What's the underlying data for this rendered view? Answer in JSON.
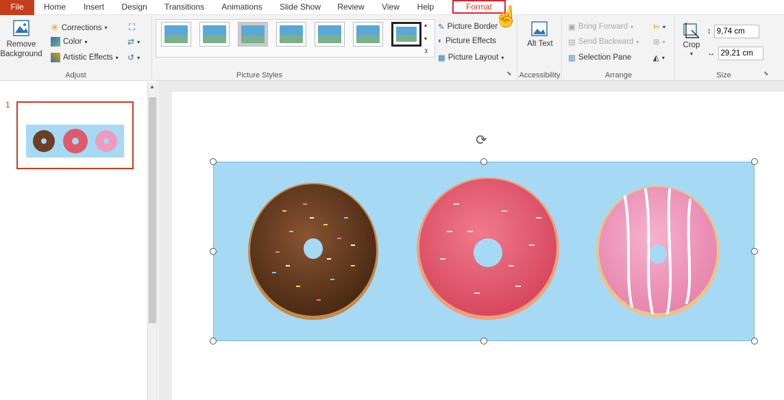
{
  "tabs": [
    "File",
    "Home",
    "Insert",
    "Design",
    "Transitions",
    "Animations",
    "Slide Show",
    "Review",
    "View",
    "Help",
    "Format"
  ],
  "ribbon": {
    "adjust": {
      "remove_bg": "Remove Background",
      "corrections": "Corrections",
      "color": "Color",
      "artistic": "Artistic Effects",
      "label": "Adjust"
    },
    "picture_styles": {
      "border": "Picture Border",
      "effects": "Picture Effects",
      "layout": "Picture Layout",
      "label": "Picture Styles"
    },
    "accessibility": {
      "alt_text": "Alt Text",
      "label": "Accessibility"
    },
    "arrange": {
      "bring_forward": "Bring Forward",
      "send_backward": "Send Backward",
      "selection_pane": "Selection Pane",
      "label": "Arrange"
    },
    "size": {
      "crop": "Crop",
      "height": "9,74 cm",
      "width": "29,21 cm",
      "label": "Size"
    }
  },
  "slides_panel": {
    "slide_number": "1"
  },
  "colors": {
    "accent": "#c43e1c",
    "slide_bg": "#a6daf4",
    "highlight": "#d7252c"
  }
}
